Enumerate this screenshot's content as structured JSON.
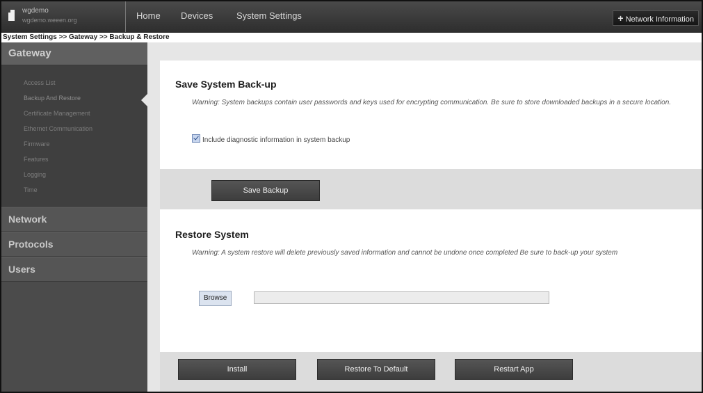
{
  "header": {
    "brand_name": "wgdemo",
    "brand_sub": "wgdemo.weeen.org",
    "nav": [
      "Home",
      "Devices",
      "System Settings"
    ],
    "network_info": "Network Information"
  },
  "breadcrumb": "System Settings >> Gateway >> Backup & Restore",
  "sidebar": {
    "header": "Gateway",
    "items": [
      "Access List",
      "Backup And Restore",
      "Certificate Management",
      "Ethernet Communication",
      "Firmware",
      "Features",
      "Logging",
      "Time"
    ],
    "sections": [
      "Network",
      "Protocols",
      "Users"
    ]
  },
  "backup": {
    "title": "Save System Back-up",
    "warning": "Warning: System backups contain user passwords and keys used for encrypting communication. Be sure to store downloaded backups in a secure location.",
    "checkbox_label": "Include diagnostic information in system backup",
    "checkbox_checked": true,
    "save_button": "Save Backup"
  },
  "restore": {
    "title": "Restore System",
    "warning": "Warning: A system restore will delete previously saved information and cannot be undone once completed Be sure to back-up your system",
    "browse_button": "Browse",
    "file_value": "",
    "install_button": "Install",
    "restore_default_button": "Restore To Default",
    "restart_button": "Restart App"
  }
}
